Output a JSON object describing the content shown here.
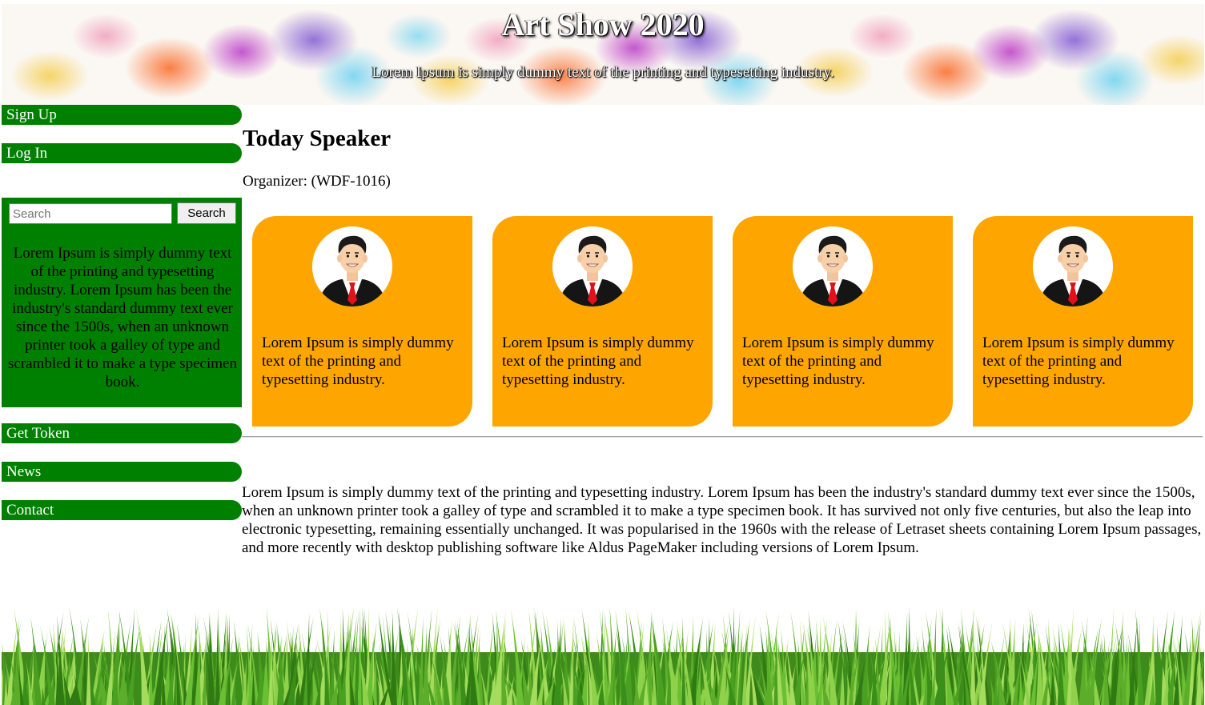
{
  "header": {
    "title": "Art Show 2020",
    "subtitle": "Lorem Ipsum is simply dummy text of the printing and typesetting industry."
  },
  "sidebar": {
    "nav_top": [
      {
        "label": "Sign Up"
      },
      {
        "label": "Log In"
      }
    ],
    "search": {
      "placeholder": "Search",
      "button_label": "Search"
    },
    "panel_text": "Lorem Ipsum is simply dummy text of the printing and typesetting industry. Lorem Ipsum has been the industry's standard dummy text ever since the 1500s, when an unknown printer took a galley of type and scrambled it to make a type specimen book.",
    "nav_bottom": [
      {
        "label": "Get Token"
      },
      {
        "label": "News"
      },
      {
        "label": "Contact"
      }
    ]
  },
  "main": {
    "title": "Today Speaker",
    "organizer": "Organizer: (WDF-1016)",
    "cards": [
      {
        "text": "Lorem Ipsum is simply dummy text of the printing and typesetting industry."
      },
      {
        "text": "Lorem Ipsum is simply dummy text of the printing and typesetting industry."
      },
      {
        "text": "Lorem Ipsum is simply dummy text of the printing and typesetting industry."
      },
      {
        "text": "Lorem Ipsum is simply dummy text of the printing and typesetting industry."
      }
    ],
    "body_text": "Lorem Ipsum is simply dummy text of the printing and typesetting industry. Lorem Ipsum has been the industry's standard dummy text ever since the 1500s, when an unknown printer took a galley of type and scrambled it to make a type specimen book. It has survived not only five centuries, but also the leap into electronic typesetting, remaining essentially unchanged. It was popularised in the 1960s with the release of Letraset sheets containing Lorem Ipsum passages, and more recently with desktop publishing software like Aldus PageMaker including versions of Lorem Ipsum."
  },
  "colors": {
    "nav_green": "#008000",
    "card_orange": "#ffa500",
    "header_title_color": "#ffffff"
  },
  "icons": {
    "avatar": "businessman-avatar-icon",
    "header_background": "watercolor-splash",
    "footer_background": "grass"
  }
}
